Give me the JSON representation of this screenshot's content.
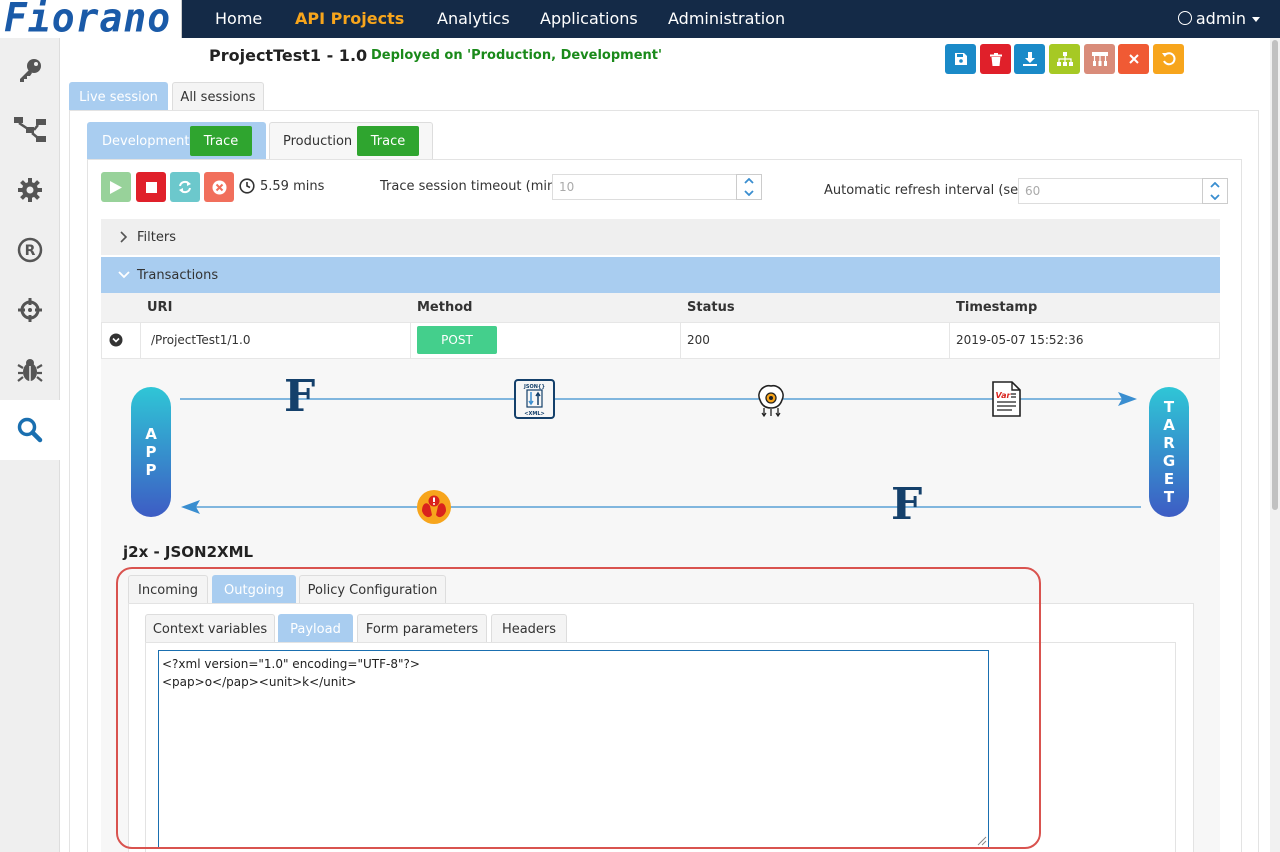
{
  "brand": {
    "logo_text": "Fiorano"
  },
  "nav": {
    "items": [
      {
        "label": "Home",
        "active": false
      },
      {
        "label": "API Projects",
        "active": true
      },
      {
        "label": "Analytics",
        "active": false
      },
      {
        "label": "Applications",
        "active": false
      },
      {
        "label": "Administration",
        "active": false
      }
    ],
    "user": "admin"
  },
  "sidebar": {
    "items": [
      {
        "icon": "key-icon",
        "active": false
      },
      {
        "icon": "flow-icon",
        "active": false
      },
      {
        "icon": "gear-icon",
        "active": false
      },
      {
        "icon": "registered-icon",
        "active": false
      },
      {
        "icon": "crosshair-icon",
        "active": false
      },
      {
        "icon": "bug-icon",
        "active": false
      },
      {
        "icon": "search-icon",
        "active": true
      }
    ]
  },
  "project": {
    "title": "ProjectTest1 - 1.0",
    "deployed": "Deployed on 'Production, Development'"
  },
  "toolbar": {
    "colors": {
      "save": "#1a8ac8",
      "delete": "#e0202a",
      "download": "#1a8ac8",
      "hierarchy": "#a6c924",
      "network": "#d98c7a",
      "close": "#f05a34",
      "undo": "#f7a51c"
    }
  },
  "session_tabs": {
    "live": "Live session",
    "all": "All sessions"
  },
  "env_tabs": {
    "development": "Development",
    "production": "Production",
    "trace_label": "Trace"
  },
  "controls": {
    "elapsed": "5.59 mins",
    "timeout_label": "Trace session timeout (mins)",
    "timeout_value": "10",
    "refresh_label": "Automatic refresh interval (secs)",
    "refresh_value": "60"
  },
  "sections": {
    "filters": "Filters",
    "transactions": "Transactions"
  },
  "table": {
    "headers": [
      "URI",
      "Method",
      "Status",
      "Timestamp"
    ],
    "rows": [
      {
        "uri": "/ProjectTest1/1.0",
        "method": "POST",
        "status": "200",
        "timestamp": "2019-05-07 15:52:36"
      }
    ]
  },
  "flow": {
    "app_letters": [
      "A",
      "P",
      "P"
    ],
    "target_letters": [
      "T",
      "A",
      "R",
      "G",
      "E",
      "T"
    ],
    "json_icon_label": "JSON{}",
    "xml_icon_label": "<XML>",
    "var_label": "Var"
  },
  "policy": {
    "title": "j2x - JSON2XML",
    "tabs": [
      "Incoming",
      "Outgoing",
      "Policy Configuration"
    ],
    "active_tab": "Outgoing",
    "sub_tabs": [
      "Context variables",
      "Payload",
      "Form parameters",
      "Headers"
    ],
    "active_sub_tab": "Payload",
    "payload_lines": [
      "<?xml version=\"1.0\" encoding=\"UTF-8\"?>",
      "<pap>o</pap><unit>k</unit>"
    ]
  }
}
